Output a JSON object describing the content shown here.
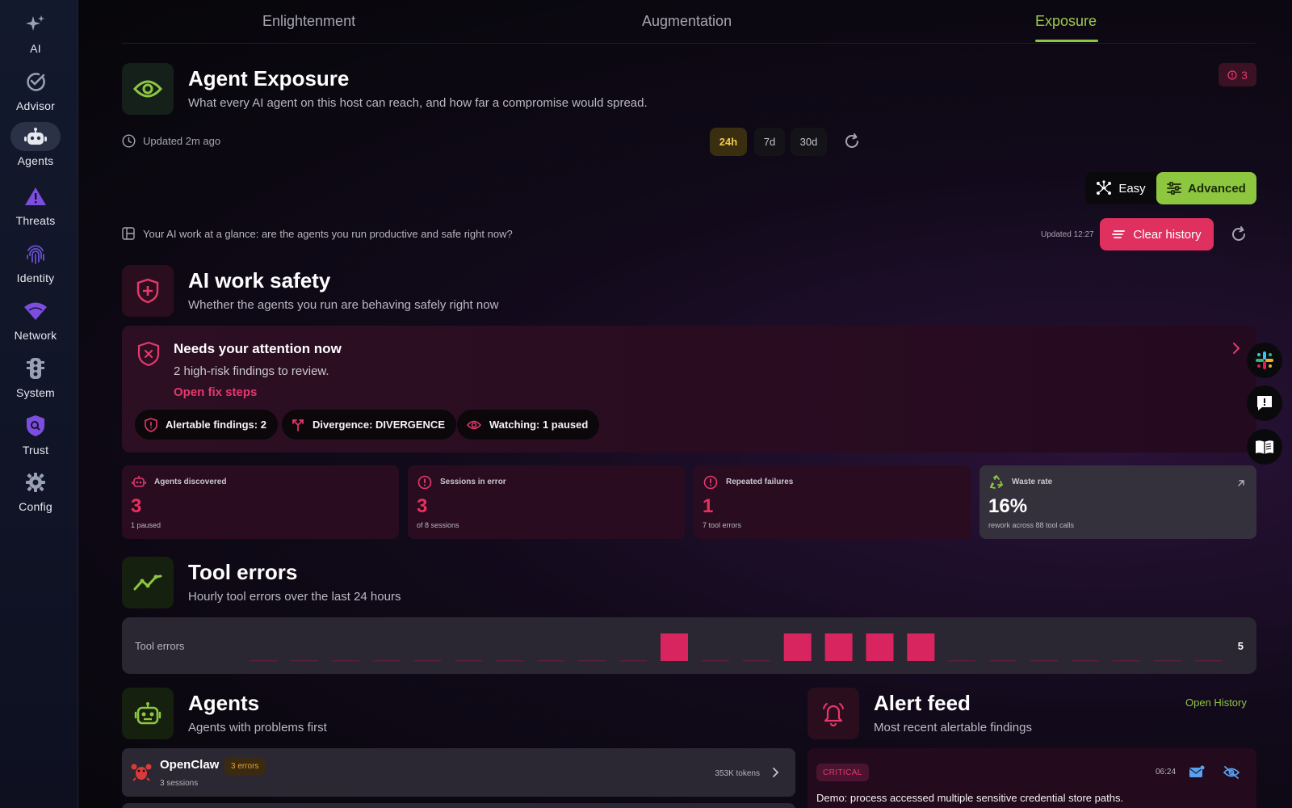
{
  "sidebar": {
    "items": [
      {
        "label": "AI",
        "icon": "sparkles-icon"
      },
      {
        "label": "Advisor",
        "icon": "check-circle-icon"
      },
      {
        "label": "Agents",
        "icon": "robot-icon",
        "active": true
      },
      {
        "label": "Threats",
        "icon": "warning-triangle-icon"
      },
      {
        "label": "Identity",
        "icon": "fingerprint-icon"
      },
      {
        "label": "Network",
        "icon": "wifi-icon"
      },
      {
        "label": "System",
        "icon": "traffic-light-icon"
      },
      {
        "label": "Trust",
        "icon": "shield-search-icon"
      },
      {
        "label": "Config",
        "icon": "gear-icon"
      }
    ]
  },
  "tabs": [
    {
      "label": "Enlightenment"
    },
    {
      "label": "Augmentation"
    },
    {
      "label": "Exposure",
      "active": true
    }
  ],
  "header": {
    "title": "Agent Exposure",
    "subtitle": "What every AI agent on this host can reach, and how far a compromise would spread.",
    "alert_count": "3",
    "updated": "Updated 2m ago"
  },
  "time_range": {
    "options": [
      "24h",
      "7d",
      "30d"
    ],
    "selected": "24h"
  },
  "mode": {
    "easy": "Easy",
    "advanced": "Advanced",
    "selected": "Advanced"
  },
  "glance": {
    "text": "Your AI work at a glance: are the agents you run productive and safe right now?",
    "updated": "Updated 12:27",
    "clear_label": "Clear history"
  },
  "safety": {
    "title": "AI work safety",
    "subtitle": "Whether the agents you run are behaving safely right now"
  },
  "attention": {
    "title": "Needs your attention now",
    "text": "2 high-risk findings to review.",
    "link": "Open fix steps",
    "chips": [
      {
        "label": "Alertable findings: 2",
        "icon": "shield-alert-icon"
      },
      {
        "label": "Divergence: DIVERGENCE",
        "icon": "fork-icon"
      },
      {
        "label": "Watching: 1 paused",
        "icon": "eye-icon"
      }
    ]
  },
  "stats": [
    {
      "label": "Agents discovered",
      "value": "3",
      "note": "1 paused",
      "icon": "robot-icon"
    },
    {
      "label": "Sessions in error",
      "value": "3",
      "note": "of 8 sessions",
      "icon": "alert-circle-icon"
    },
    {
      "label": "Repeated failures",
      "value": "1",
      "note": "7 tool errors",
      "icon": "alert-circle-icon"
    },
    {
      "label": "Waste rate",
      "value": "16%",
      "note": "rework across 88 tool calls",
      "icon": "recycle-icon"
    }
  ],
  "tool_errors": {
    "title": "Tool errors",
    "subtitle": "Hourly tool errors over the last 24 hours",
    "label": "Tool errors",
    "total": "5"
  },
  "chart_data": {
    "type": "bar",
    "categories": [
      "h1",
      "h2",
      "h3",
      "h4",
      "h5",
      "h6",
      "h7",
      "h8",
      "h9",
      "h10",
      "h11",
      "h12",
      "h13",
      "h14",
      "h15",
      "h16",
      "h17",
      "h18",
      "h19",
      "h20",
      "h21",
      "h22",
      "h23",
      "h24"
    ],
    "values": [
      0,
      0,
      0,
      0,
      0,
      0,
      0,
      0,
      0,
      0,
      1,
      0,
      0,
      1,
      1,
      1,
      1,
      0,
      0,
      0,
      0,
      0,
      0,
      0
    ],
    "title": "Tool errors",
    "xlabel": "",
    "ylabel": "",
    "ylim": [
      0,
      1
    ],
    "colors": {
      "bar": "#d8255f",
      "baseline": "#5a1f3a"
    }
  },
  "agents": {
    "title": "Agents",
    "subtitle": "Agents with problems first",
    "rows": [
      {
        "name": "OpenClaw",
        "badge": "3 errors",
        "sessions": "3 sessions",
        "tokens": "353K tokens"
      }
    ]
  },
  "alert_feed": {
    "title": "Alert feed",
    "subtitle": "Most recent alertable findings",
    "link": "Open History",
    "items": [
      {
        "severity": "CRITICAL",
        "time": "06:24",
        "text": "Demo: process accessed multiple sensitive credential store paths."
      }
    ]
  },
  "colors": {
    "accent_green": "#8dc63f",
    "danger_pink": "#e0305f",
    "amber": "#f2c94c"
  }
}
